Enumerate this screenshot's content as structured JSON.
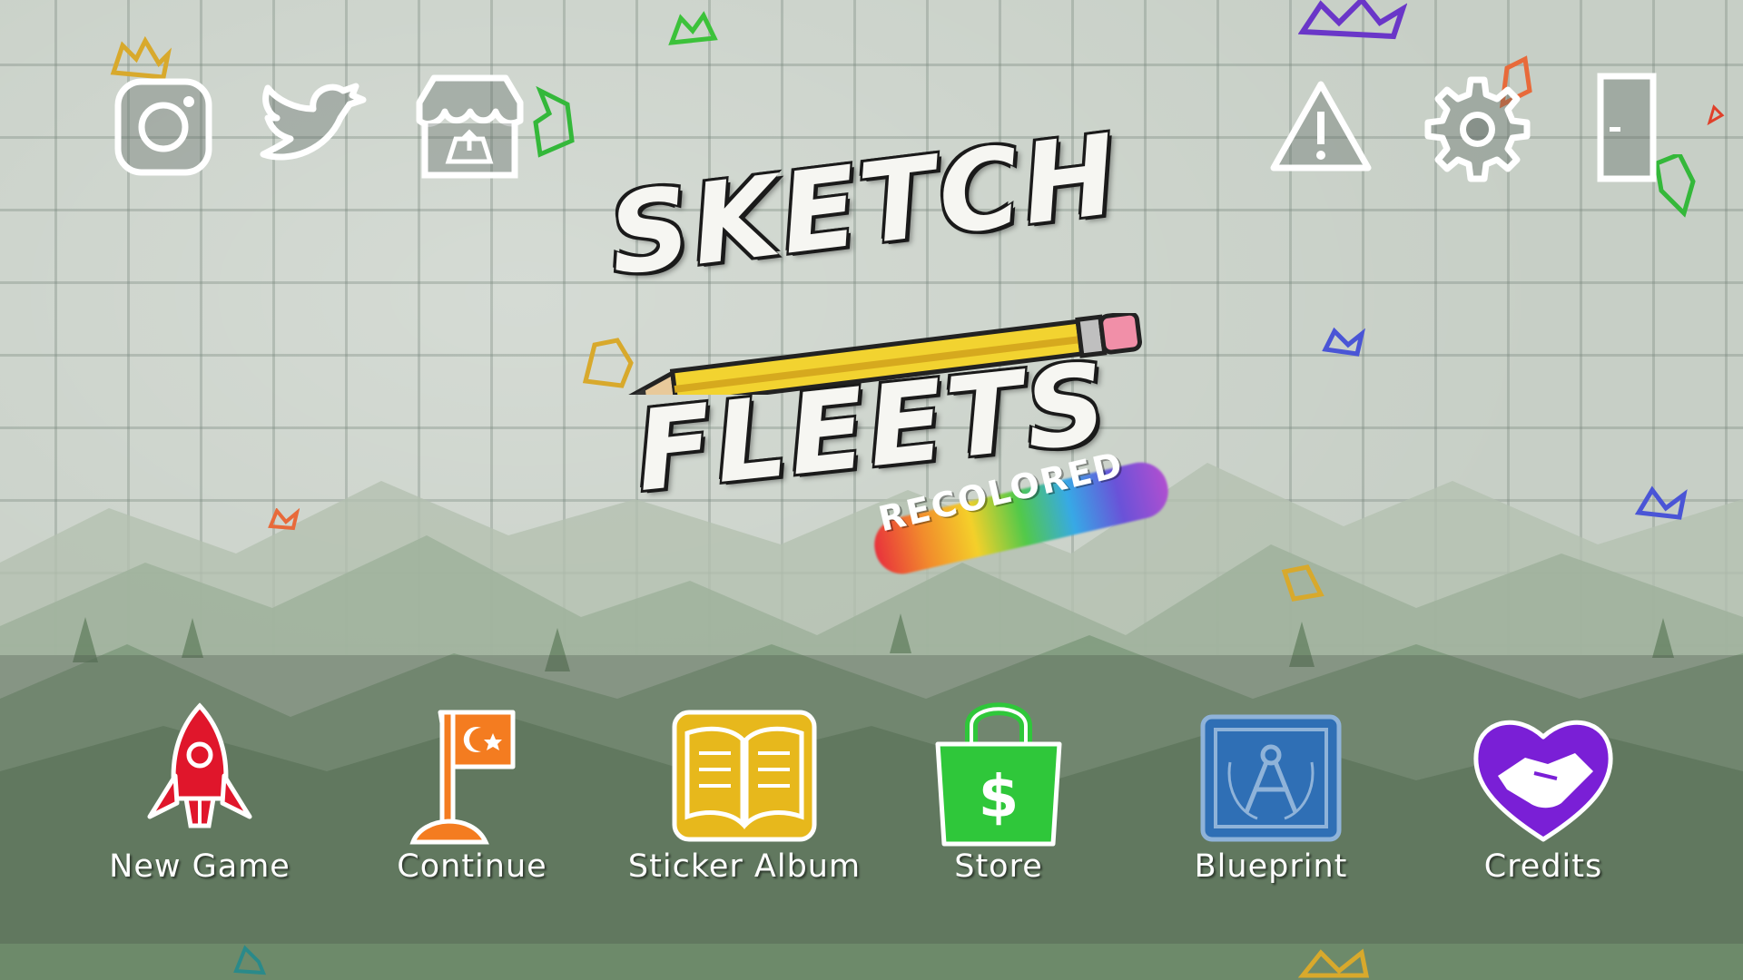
{
  "title": {
    "line1": "SKETCH",
    "line2": "FLEETS",
    "subtitle": "RECOLORED"
  },
  "top_left_icons": [
    {
      "name": "instagram-icon"
    },
    {
      "name": "twitter-icon"
    },
    {
      "name": "itch-io-store-icon"
    }
  ],
  "top_right_icons": [
    {
      "name": "warning-icon"
    },
    {
      "name": "gear-icon"
    },
    {
      "name": "exit-door-icon"
    }
  ],
  "menu": {
    "new_game": {
      "label": "New Game",
      "icon": "rocket-icon",
      "color": "#e0162b"
    },
    "continue": {
      "label": "Continue",
      "icon": "flag-icon",
      "color": "#f47c20"
    },
    "sticker_album": {
      "label": "Sticker Album",
      "icon": "book-icon",
      "color": "#e7b81c"
    },
    "store": {
      "label": "Store",
      "icon": "shopping-bag-icon",
      "color": "#2fc73a"
    },
    "blueprint": {
      "label": "Blueprint",
      "icon": "blueprint-icon",
      "color": "#2f6fb5"
    },
    "credits": {
      "label": "Credits",
      "icon": "handshake-heart-icon",
      "color": "#7a1fd6"
    }
  }
}
